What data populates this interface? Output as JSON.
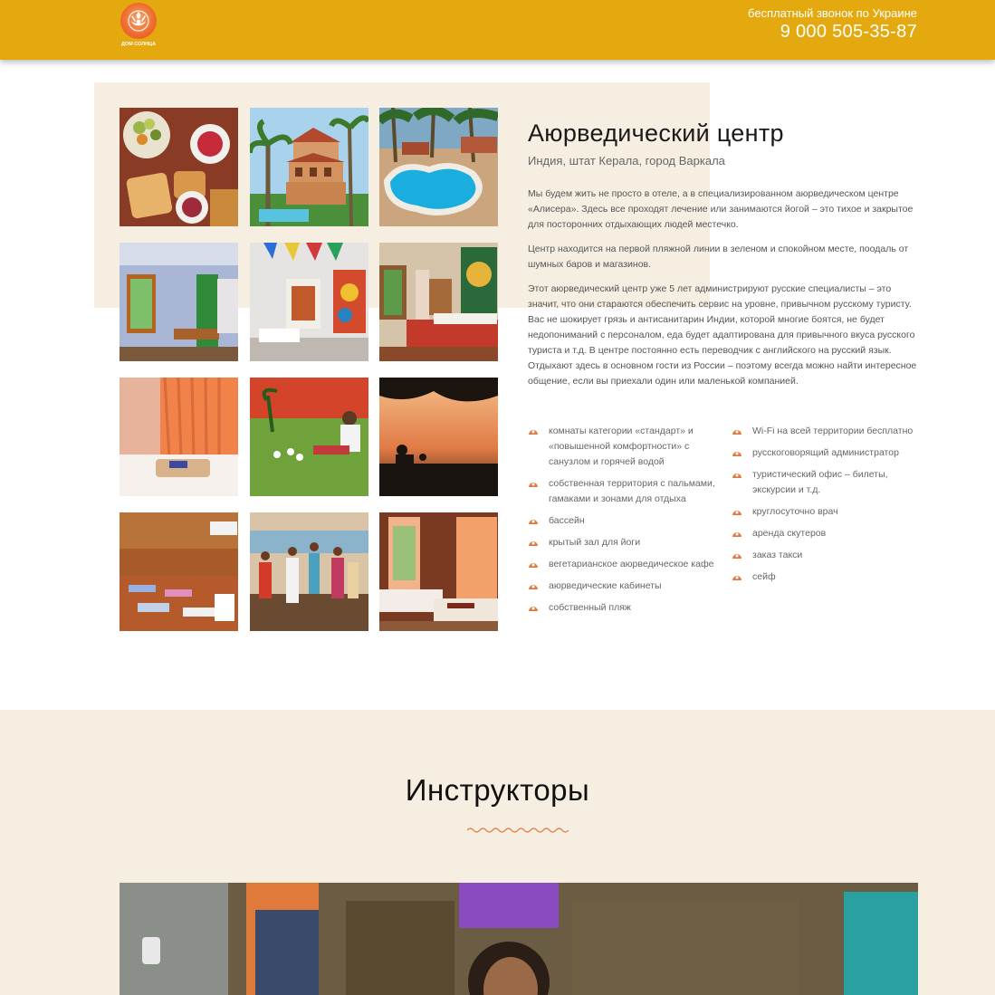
{
  "header": {
    "logo_text": "ДОМ СОЛНЦА",
    "logo_sub": "",
    "hotline": "бесплатный звонок по Украине",
    "phone": "9 000 505-35-87"
  },
  "center": {
    "title": "Аюрведический центр",
    "location": "Индия, штат Керала, город Варкала",
    "paragraphs": [
      "Мы будем жить не просто в отеле, а в специализированном аюрведическом центре «Алисера». Здесь все проходят лечение или занимаются йогой – это тихое и закрытое для посторонних отдыхающих людей местечко.",
      "Центр находится на первой пляжной линии в зеленом и спокойном месте, поодаль от шумных баров и магазинов.",
      "Этот аюрведический центр уже 5 лет администрируют русские специалисты – это значит, что они стараются обеспечить сервис на уровне, привычном русскому туристу. Вас не шокирует грязь и антисанитарин Индии, которой многие боятся, не будет недопониманий с персоналом, еда будет адаптирована для привычного вкуса русского туриста и т.д. В центре постоянно есть переводчик с английского на русский язык. Отдыхают здесь в основном гости из России – поэтому всегда можно найти интересное общение, если вы приехали один или маленькой компанией."
    ],
    "features_left": [
      "комнаты категории «стандарт» и «повышенной комфортности» с санузлом и горячей водой",
      "собственная территория с пальмами, гамаками и зонами для отдыха",
      "бассейн",
      "крытый зал для йоги",
      "вегетарианское аюрведическое кафе",
      "аюрведические кабинеты",
      "собственный пляж"
    ],
    "features_right": [
      "Wi-Fi на всей территории бесплатно",
      "русскоговорящий администратор",
      "туристический офис – билеты, экскурсии и т.д.",
      "круглосуточно врач",
      "аренда скутеров",
      "заказ такси",
      "сейф"
    ]
  },
  "gallery": [
    {
      "name": "photo-breakfast"
    },
    {
      "name": "photo-tower-building"
    },
    {
      "name": "photo-pool"
    },
    {
      "name": "photo-room-blue"
    },
    {
      "name": "photo-room-window"
    },
    {
      "name": "photo-room-bed"
    },
    {
      "name": "photo-room-curtains"
    },
    {
      "name": "photo-garden-lawn"
    },
    {
      "name": "photo-sunset-sea"
    },
    {
      "name": "photo-yoga-hall"
    },
    {
      "name": "photo-group-beach"
    },
    {
      "name": "photo-room-twin"
    }
  ],
  "instructors": {
    "title": "Инструкторы"
  },
  "colors": {
    "header_bg": "#e3a90f",
    "beige": "#f6efe1",
    "accent": "#e2793f"
  }
}
